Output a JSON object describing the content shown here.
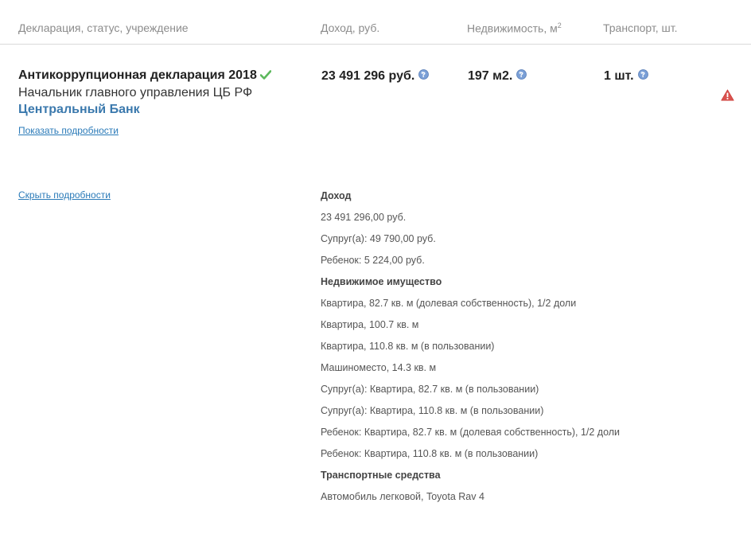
{
  "header": {
    "col_declaration": "Декларация, статус, учреждение",
    "col_income": "Доход, руб.",
    "col_realty": "Недвижимость, м",
    "col_realty_sup": "2",
    "col_transport": "Транспорт, шт."
  },
  "declaration": {
    "title": "Антикоррупционная декларация 2018",
    "position": "Начальник главного управления ЦБ РФ",
    "organization": "Центральный Банк",
    "show_details": "Показать подробности",
    "hide_details": "Скрыть подробности",
    "income": "23 491 296 руб.",
    "realty": "197 м2.",
    "transport": "1 шт."
  },
  "icons": {
    "verified": "check-icon",
    "help": "question-circle-icon",
    "warning": "warning-triangle-icon"
  },
  "colors": {
    "accent_link": "#2a7ab8",
    "organization": "#3b79ad",
    "check": "#5cb85c",
    "warning": "#d9534f",
    "help": "#6b8fc7"
  },
  "details": {
    "income_heading": "Доход",
    "income_lines": [
      "23 491 296,00 руб.",
      "Супруг(а): 49 790,00 руб.",
      "Ребенок: 5 224,00 руб."
    ],
    "realty_heading": "Недвижимое имущество",
    "realty_lines": [
      "Квартира, 82.7 кв. м (долевая собственность), 1/2 доли",
      "Квартира, 100.7 кв. м",
      "Квартира, 110.8 кв. м (в пользовании)",
      "Машиноместо, 14.3 кв. м",
      "Супруг(а): Квартира, 82.7 кв. м (в пользовании)",
      "Супруг(а): Квартира, 110.8 кв. м (в пользовании)",
      "Ребенок: Квартира, 82.7 кв. м (долевая собственность), 1/2 доли",
      "Ребенок: Квартира, 110.8 кв. м (в пользовании)"
    ],
    "transport_heading": "Транспортные средства",
    "transport_lines": [
      "Автомобиль легковой, Toyota Rav 4"
    ]
  }
}
